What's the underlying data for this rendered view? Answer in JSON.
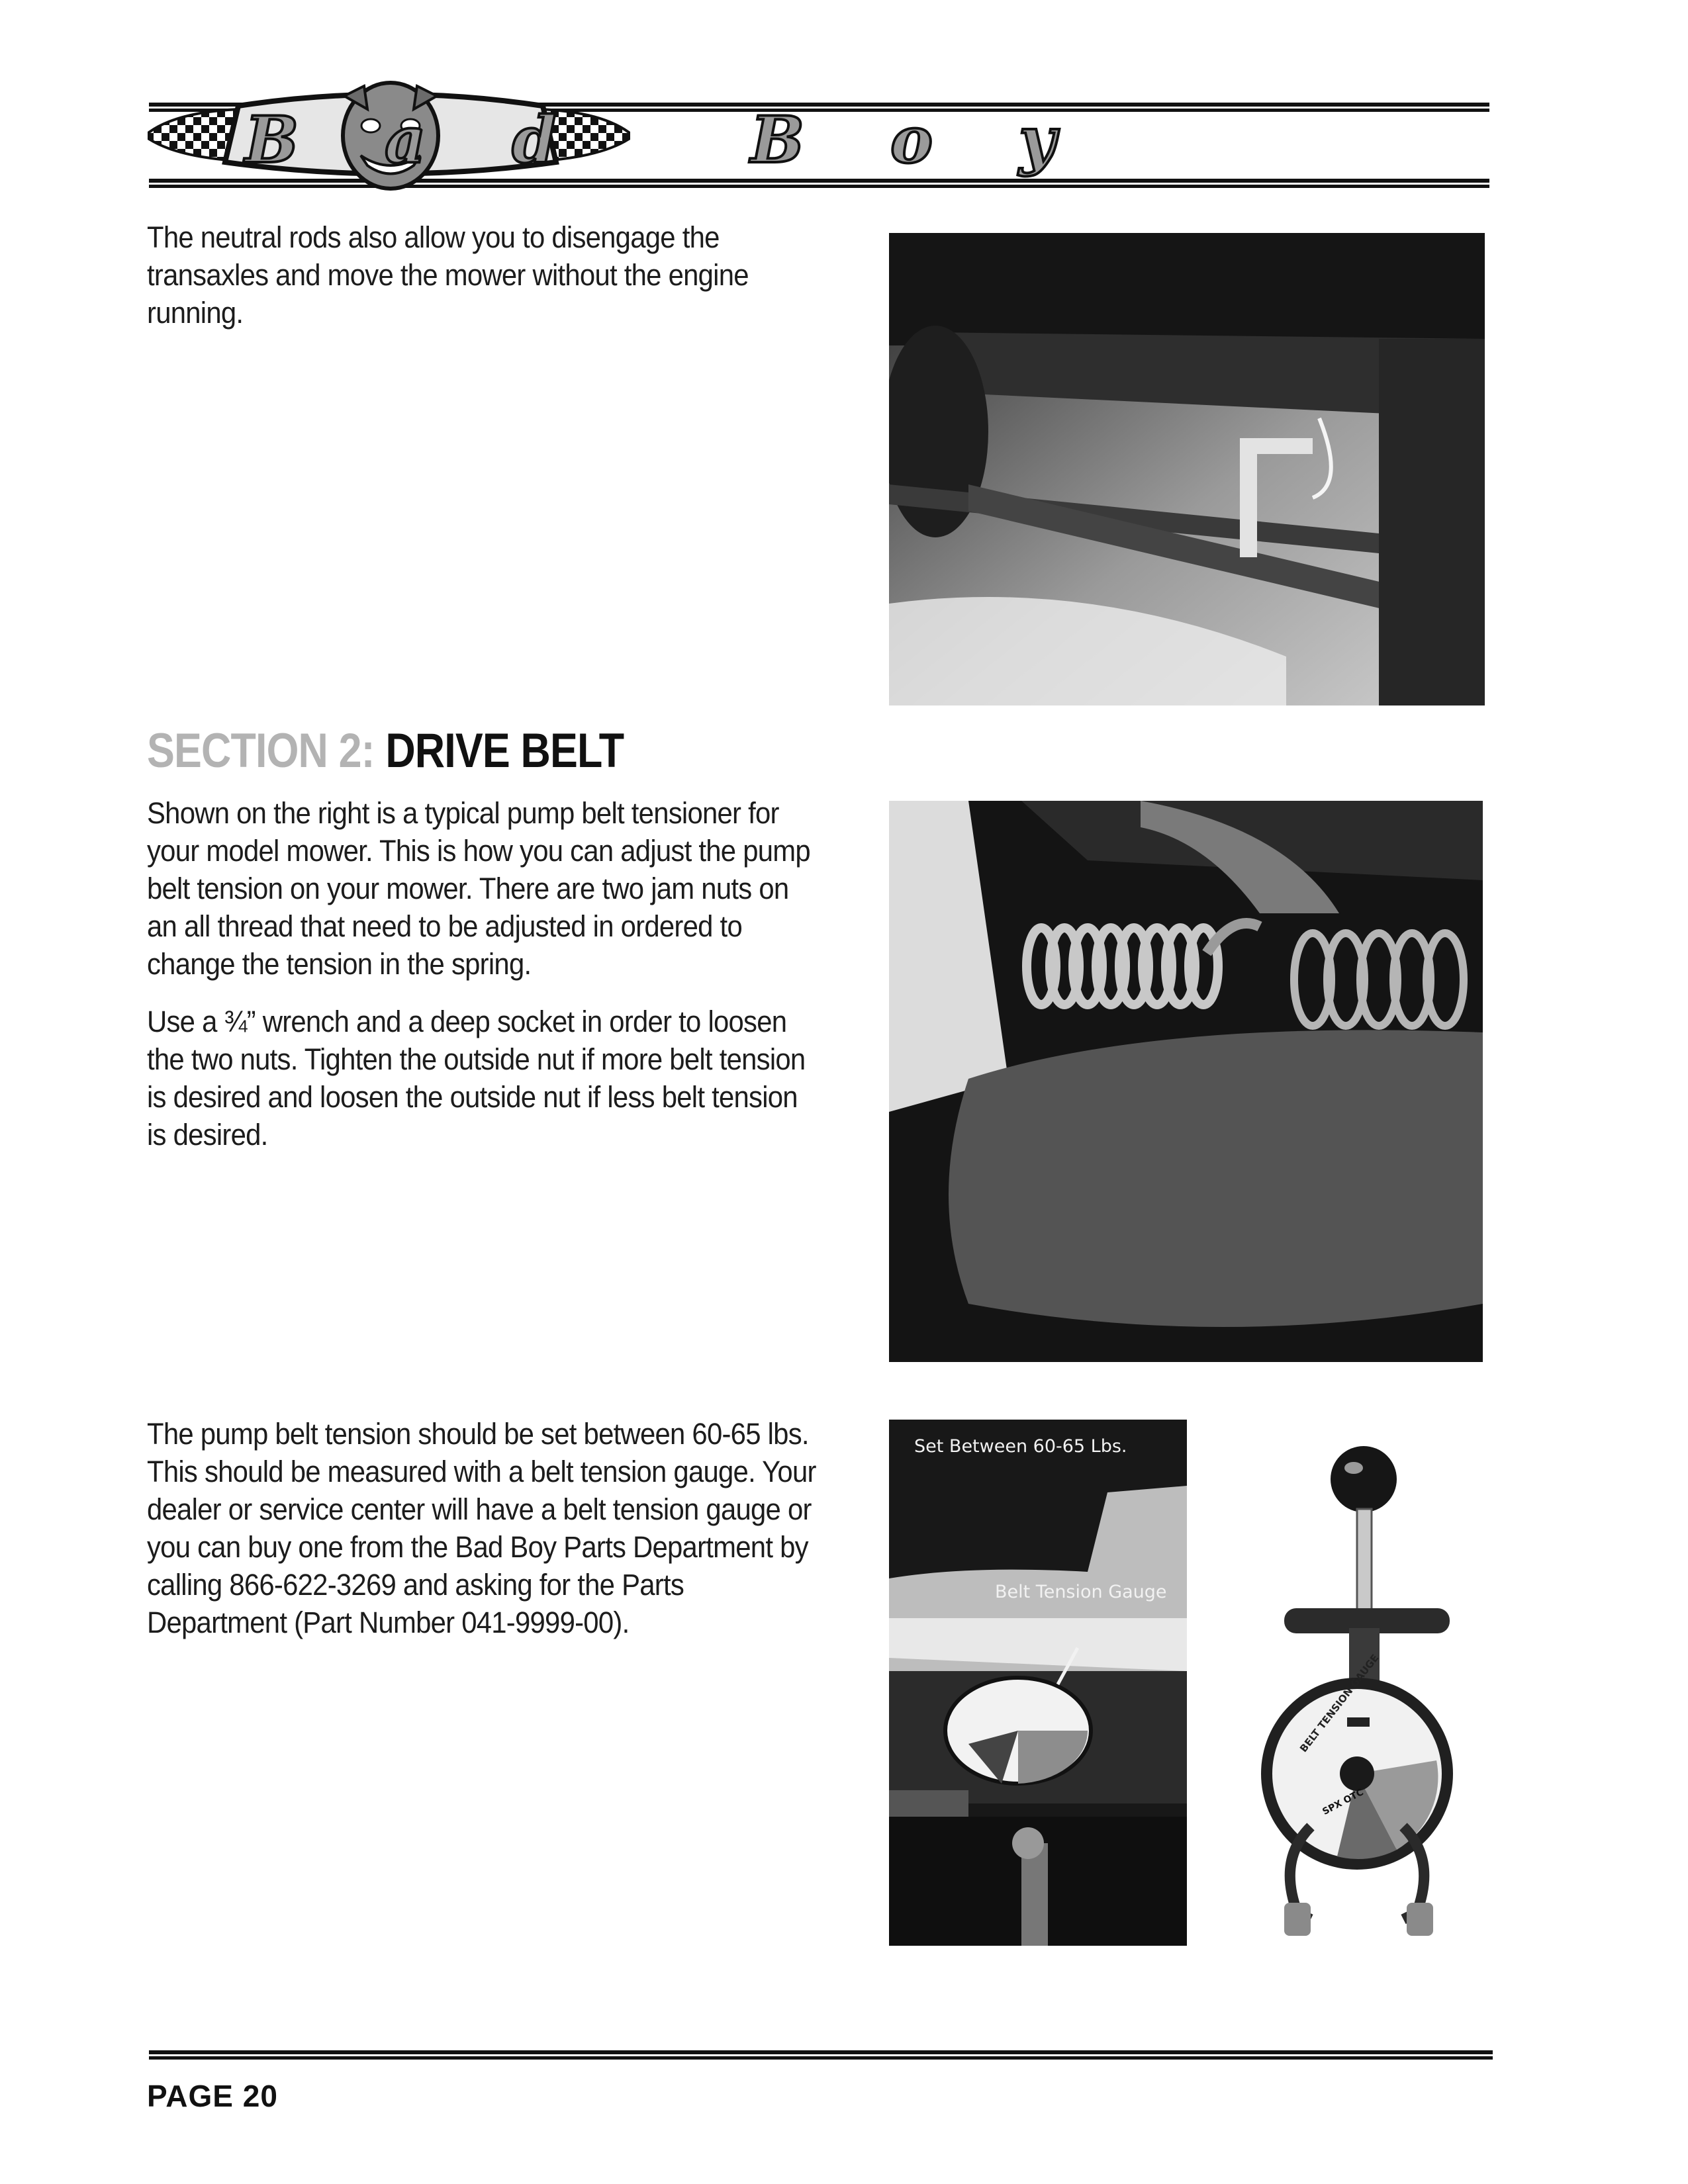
{
  "brand": {
    "logo_text": "Bad Boy"
  },
  "intro": {
    "text": "The neutral rods also allow you to disengage the transaxles and move the mower without the engine running."
  },
  "section": {
    "prefix": "SECTION 2:",
    "title": "DRIVE BELT"
  },
  "paragraphs": [
    "Shown on the right is a typical pump belt tensioner for your model mower. This is how you can adjust the pump belt tension on your mower. There are two jam nuts on an all thread that need to be adjusted in ordered to change the tension in the spring.",
    "Use a ¾” wrench and a deep socket in order to loosen the two nuts. Tighten the outside nut if more belt tension is desired and loosen the outside nut if less belt tension is desired.",
    "The pump belt tension should be set between 60-65 lbs. This should be measured with a belt tension gauge. Your dealer or service center will have a belt tension gauge or you can buy one from the Bad Boy Parts Department by calling 866-622-3269 and asking for the Parts Department (Part Number 041-9999-00)."
  ],
  "photos": {
    "gauge_caption_top": "Set Between 60-65 Lbs.",
    "gauge_caption_label": "Belt Tension Gauge",
    "gauge_dial_text": "BELT TENSION GAUGE",
    "gauge_brand": "SPX OTC"
  },
  "footer": {
    "page_label": "PAGE  20"
  }
}
